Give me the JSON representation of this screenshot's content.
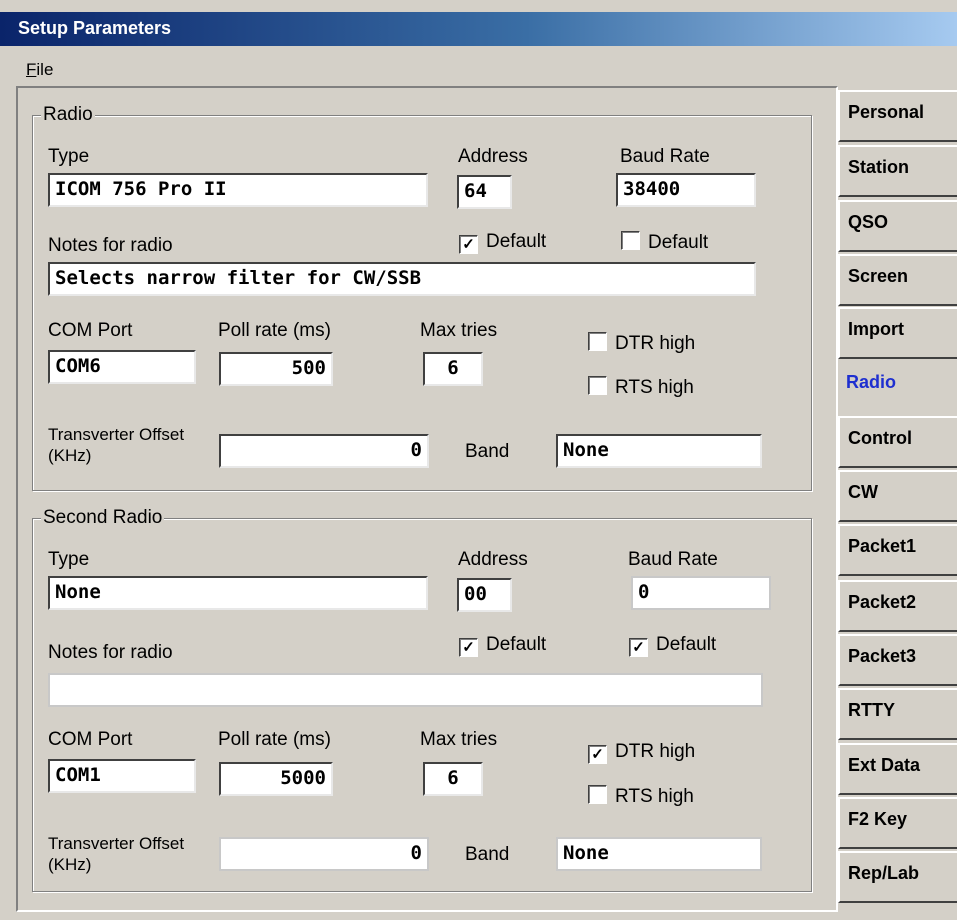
{
  "window": {
    "title": "Setup Parameters"
  },
  "menu": {
    "file_first": "F",
    "file_rest": "ile"
  },
  "tabs": [
    "Personal",
    "Station",
    "QSO",
    "Screen",
    "Import",
    "Radio",
    "Control",
    "CW",
    "Packet1",
    "Packet2",
    "Packet3",
    "RTTY",
    "Ext Data",
    "F2 Key",
    "Rep/Lab"
  ],
  "active_tab": "Radio",
  "radio1": {
    "group_title": "Radio",
    "type_label": "Type",
    "type_value": "ICOM 756 Pro II",
    "address_label": "Address",
    "address_value": "64",
    "baud_label": "Baud Rate",
    "baud_value": "38400",
    "notes_label": "Notes for radio",
    "notes_value": "Selects narrow filter for CW/SSB",
    "address_default": {
      "label": "Default",
      "checked": true
    },
    "baud_default": {
      "label": "Default",
      "checked": false
    },
    "com_label": "COM Port",
    "com_value": "COM6",
    "poll_label": "Poll rate (ms)",
    "poll_value": "500",
    "max_label": "Max tries",
    "max_value": "6",
    "dtr": {
      "label": "DTR high",
      "checked": false
    },
    "rts": {
      "label": "RTS high",
      "checked": false
    },
    "transverter_label": "Transverter Offset (KHz)",
    "transverter_value": "0",
    "band_label": "Band",
    "band_value": "None"
  },
  "radio2": {
    "group_title": "Second Radio",
    "type_label": "Type",
    "type_value": "None",
    "address_label": "Address",
    "address_value": "00",
    "baud_label": "Baud Rate",
    "baud_value": "0",
    "notes_label": "Notes for radio",
    "notes_value": "",
    "address_default": {
      "label": "Default",
      "checked": true
    },
    "baud_default": {
      "label": "Default",
      "checked": true
    },
    "com_label": "COM Port",
    "com_value": "COM1",
    "poll_label": "Poll rate (ms)",
    "poll_value": "5000",
    "max_label": "Max tries",
    "max_value": "6",
    "dtr": {
      "label": "DTR high",
      "checked": true
    },
    "rts": {
      "label": "RTS high",
      "checked": false
    },
    "transverter_label": "Transverter Offset (KHz)",
    "transverter_value": "0",
    "band_label": "Band",
    "band_value": "None"
  }
}
